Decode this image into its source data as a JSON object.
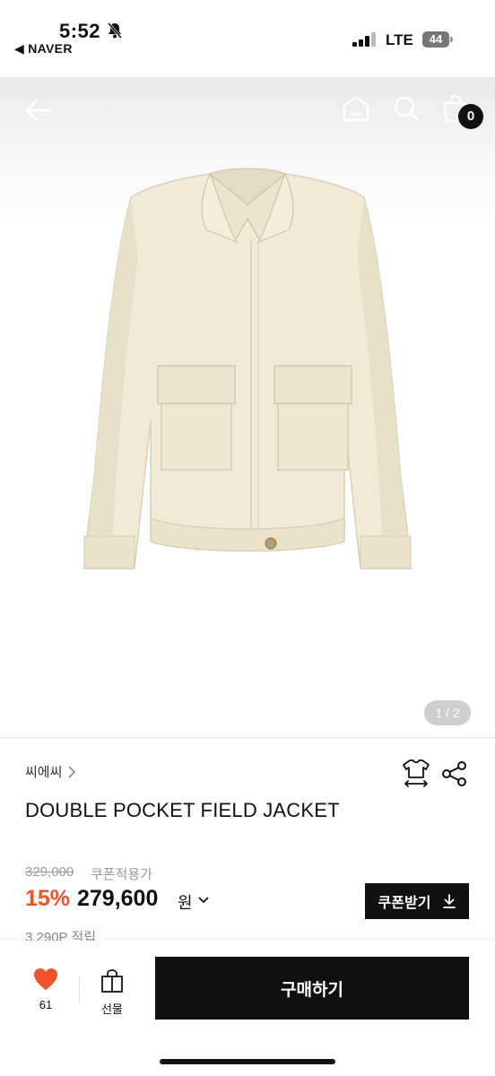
{
  "status_bar": {
    "time": "5:52",
    "back_app": "◀ NAVER",
    "network": "LTE",
    "battery": "44"
  },
  "header": {
    "cart_count": "0"
  },
  "gallery": {
    "page_indicator": "1 / 2"
  },
  "product": {
    "brand": "씨에씨",
    "name": "DOUBLE POCKET FIELD JACKET",
    "original_price": "329,000",
    "coupon_note": "쿠폰적용가",
    "discount": "15%",
    "price": "279,600",
    "currency": "원",
    "coupon_button": "쿠폰받기",
    "points": "3,290P 적립"
  },
  "bottom_bar": {
    "like_count": "61",
    "gift_label": "선물",
    "buy_label": "구매하기"
  },
  "colors": {
    "accent": "#f0522a",
    "primary": "#111111",
    "jacket": "#f1ebd6"
  }
}
